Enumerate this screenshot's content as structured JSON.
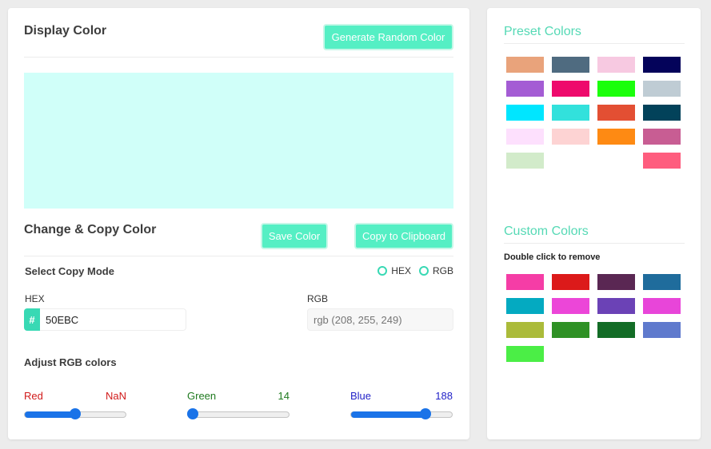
{
  "display": {
    "title": "Display Color",
    "generate_label": "Generate Random Color",
    "current_color": "#d0fff9"
  },
  "change": {
    "title": "Change & Copy Color",
    "save_label": "Save Color",
    "copy_label": "Copy to Clipboard",
    "copy_mode_label": "Select Copy Mode",
    "mode_hex": "HEX",
    "mode_rgb": "RGB",
    "hex_label": "HEX",
    "hex_prefix": "#",
    "hex_value": "50EBC",
    "rgb_label": "RGB",
    "rgb_placeholder": "rgb (208, 255, 249)"
  },
  "sliders": {
    "title": "Adjust RGB colors",
    "red": {
      "label": "Red",
      "value": "NaN",
      "color": "#d11a1a",
      "level_percent": 50
    },
    "green": {
      "label": "Green",
      "value": "14",
      "color": "#1f7a1f",
      "level_percent": 5
    },
    "blue": {
      "label": "Blue",
      "value": "188",
      "color": "#2323c8",
      "level_percent": 74
    }
  },
  "accent": "#55efc4",
  "presets": {
    "title": "Preset Colors",
    "colors": [
      "#e9a37b",
      "#4f6b80",
      "#f7c9e1",
      "#04035a",
      "#a45cd4",
      "#ee0a6c",
      "#1bff0c",
      "#bfccd4",
      "#00e6ff",
      "#32e1dc",
      "#e34f33",
      "#02425a",
      "#fde0fd",
      "#fdd3d3",
      "#fe8a13",
      "#c85d93",
      "#d2ebca",
      "",
      "",
      "#fe5d7e"
    ]
  },
  "custom": {
    "title": "Custom Colors",
    "note": "Double click to remove",
    "colors": [
      "#f53da6",
      "#dc1a1a",
      "#5a2753",
      "#1f6c9c",
      "#04aac1",
      "#ec46d8",
      "#6b42b6",
      "#e845d9",
      "#abbb3a",
      "#2f9125",
      "#136c26",
      "#5f7acd",
      "#4bee46"
    ]
  }
}
